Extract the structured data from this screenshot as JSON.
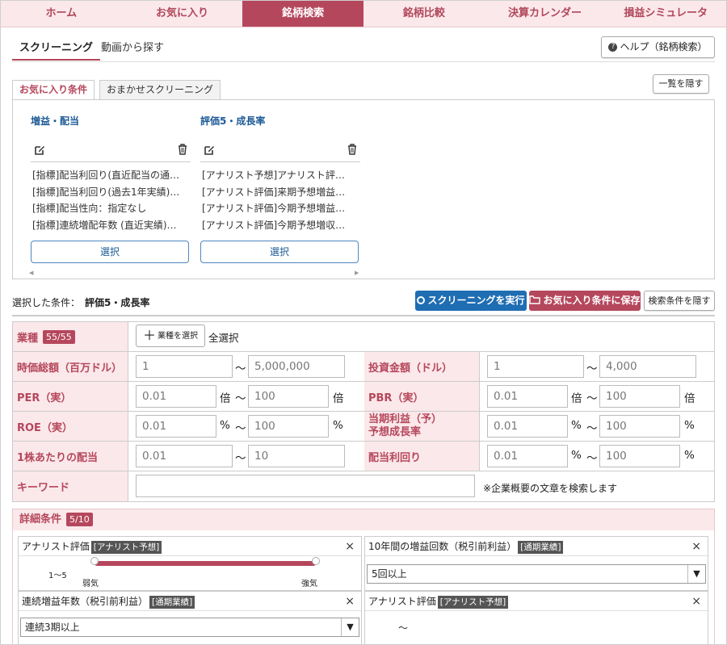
{
  "nav": [
    "ホーム",
    "お気に入り",
    "銘柄検索",
    "銘柄比較",
    "決算カレンダー",
    "損益シミュレータ"
  ],
  "subtabs": {
    "screening": "スクリーニング",
    "video": "動画から探す"
  },
  "help_label": "ヘルプ（銘柄検索）",
  "fav_tabs": {
    "fav": "お気に入り条件",
    "omakase": "おまかせスクリーニング"
  },
  "hide_list": "一覧を隠す",
  "cards": [
    {
      "title": "増益・配当",
      "items": [
        "[指標]配当利回り(直近配当の通…",
        "[指標]配当利回り(過去1年実績)…",
        "[指標]配当性向：指定なし",
        "[指標]連続増配年数 (直近実績)…"
      ],
      "select": "選択"
    },
    {
      "title": "評価5・成長率",
      "items": [
        "[アナリスト予想]アナリスト評…",
        "[アナリスト評価]来期予想増益…",
        "[アナリスト評価]今期予想増益…",
        "[アナリスト評価]今期予想増収…"
      ],
      "select": "選択"
    }
  ],
  "selected": {
    "label": "選択した条件：",
    "value": "評価5・成長率"
  },
  "buttons": {
    "run": "スクリーニングを実行",
    "save": "お気に入り条件に保存",
    "hide": "検索条件を隠す"
  },
  "form": {
    "industry": {
      "label": "業種",
      "badge": "55/55",
      "add": "業種を選択",
      "all": "全選択"
    },
    "mcap": {
      "label": "時価総額（百万ドル）",
      "from": "1",
      "to": "5,000,000"
    },
    "invest": {
      "label": "投資金額（ドル）",
      "from": "1",
      "to": "4,000"
    },
    "per": {
      "label": "PER（実）",
      "from": "0.01",
      "to": "100",
      "unit": "倍"
    },
    "pbr": {
      "label": "PBR（実）",
      "from": "0.01",
      "to": "100",
      "unit": "倍"
    },
    "roe": {
      "label": "ROE（実）",
      "from": "0.01",
      "to": "100",
      "unit": "%"
    },
    "growth": {
      "label1": "当期利益（予）",
      "label2": "予想成長率",
      "from": "0.01",
      "to": "100",
      "unit": "%"
    },
    "dps": {
      "label": "1株あたりの配当",
      "from": "0.01",
      "to": "10"
    },
    "yield": {
      "label": "配当利回り",
      "from": "0.01",
      "to": "100",
      "unit": "%"
    },
    "keyword": {
      "label": "キーワード",
      "note": "※企業概要の文章を検索します"
    },
    "tilde": "～"
  },
  "detail": {
    "label": "詳細条件",
    "badge": "5/10",
    "analyst": {
      "title": "アナリスト評価",
      "tag": "[アナリスト予想]",
      "range": "1～5",
      "low": "弱気",
      "high": "強気"
    },
    "profit_count": {
      "title": "10年間の増益回数（税引前利益）",
      "tag": "[通期業績]",
      "value": "5回以上"
    },
    "consec": {
      "title": "連続増益年数（税引前利益）",
      "tag": "[通期業績]",
      "value": "連続3期以上"
    },
    "analyst2": {
      "title": "アナリスト評価",
      "tag": "[アナリスト予想]",
      "tilde": "～"
    },
    "close": "×"
  },
  "colors": {
    "accent": "#b5475c",
    "blue": "#1f6db3",
    "pink_bg": "#fbe8ea"
  }
}
